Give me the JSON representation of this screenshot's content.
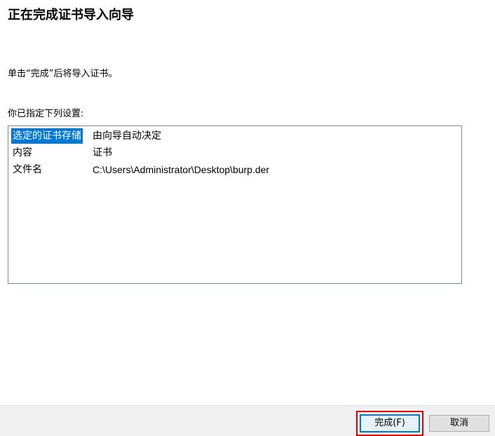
{
  "wizard": {
    "title": "正在完成证书导入向导",
    "instruction": "单击“完成”后将导入证书。",
    "list_label": "你已指定下列设置:"
  },
  "settings": [
    {
      "key": "选定的证书存储",
      "value": "由向导自动决定",
      "selected": true
    },
    {
      "key": "内容",
      "value": "证书",
      "selected": false
    },
    {
      "key": "文件名",
      "value": "C:\\Users\\Administrator\\Desktop\\burp.der",
      "selected": false
    }
  ],
  "buttons": {
    "finish_label": "完成(F)",
    "cancel_label": "取消"
  },
  "colors": {
    "selection": "#0078d7",
    "highlight_box": "#e00000",
    "footer_bg": "#f0f0f0"
  }
}
